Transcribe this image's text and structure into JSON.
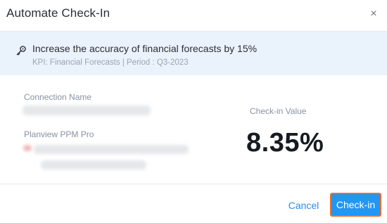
{
  "dialog": {
    "title": "Automate Check-In",
    "close_icon": "close-icon",
    "close_glyph": "×"
  },
  "kpi": {
    "icon": "key-icon",
    "title": "Increase the accuracy of financial forecasts by 15%",
    "meta": "KPI: Financial Forecasts | Period : Q3-2023"
  },
  "connection": {
    "label": "Connection Name",
    "source_label": "Planview PPM Pro"
  },
  "checkin": {
    "value_label": "Check-in Value",
    "value": "8.35%"
  },
  "footer": {
    "cancel_label": "Cancel",
    "checkin_label": "Check-in"
  },
  "colors": {
    "accent": "#2196f3",
    "focus_outline": "#e8702a",
    "banner_bg": "#eaf2fb"
  }
}
